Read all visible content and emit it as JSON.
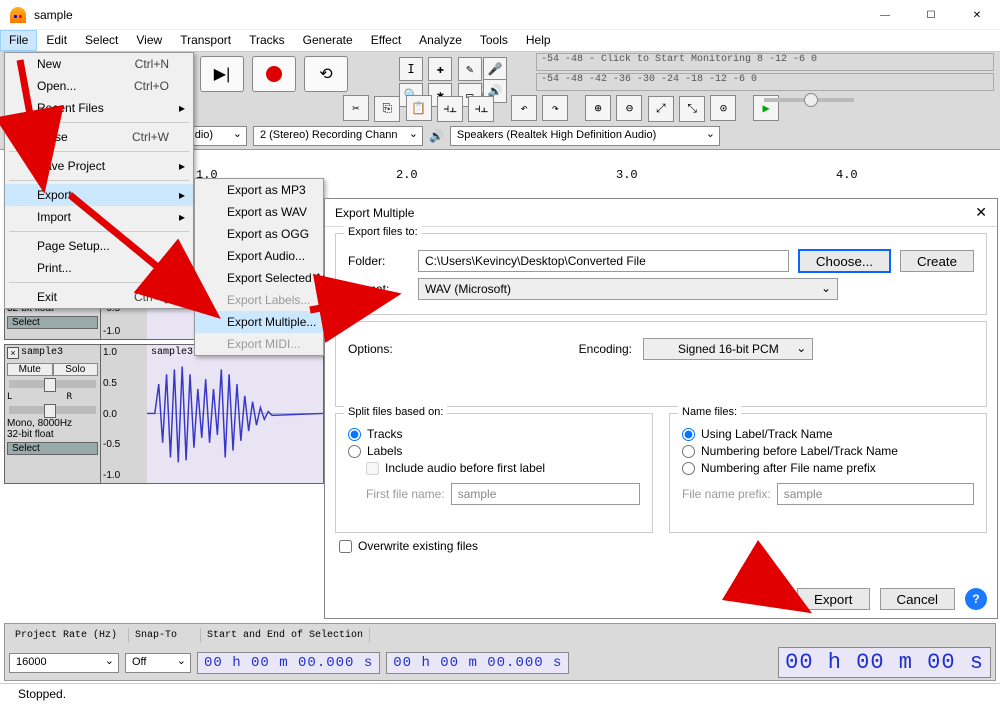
{
  "title": "sample",
  "winbuttons": {
    "min": "—",
    "max": "☐",
    "close": "✕"
  },
  "menubar": [
    "File",
    "Edit",
    "Select",
    "View",
    "Transport",
    "Tracks",
    "Generate",
    "Effect",
    "Analyze",
    "Tools",
    "Help"
  ],
  "fileMenu": [
    {
      "label": "New",
      "shortcut": "Ctrl+N"
    },
    {
      "label": "Open...",
      "shortcut": "Ctrl+O"
    },
    {
      "label": "Recent Files",
      "sub": true
    },
    {
      "sep": true
    },
    {
      "label": "Close",
      "shortcut": "Ctrl+W"
    },
    {
      "sep": true
    },
    {
      "label": "Save Project",
      "sub": true
    },
    {
      "sep": true
    },
    {
      "label": "Export",
      "sub": true,
      "sel": true
    },
    {
      "label": "Import",
      "sub": true
    },
    {
      "sep": true
    },
    {
      "label": "Page Setup..."
    },
    {
      "label": "Print..."
    },
    {
      "sep": true
    },
    {
      "label": "Exit",
      "shortcut": "Ctrl+Q"
    }
  ],
  "exportMenu": [
    {
      "label": "Export as MP3"
    },
    {
      "label": "Export as WAV"
    },
    {
      "label": "Export as OGG"
    },
    {
      "label": "Export Audio..."
    },
    {
      "label": "Export Selected Audio..."
    },
    {
      "label": "Export Labels...",
      "dis": true
    },
    {
      "label": "Export Multiple...",
      "sel": true
    },
    {
      "label": "Export MIDI...",
      "dis": true
    }
  ],
  "toolbars": {
    "meterTop": " -54   -48   - Click to Start Monitoring 8    -12    -6    0",
    "meterBot": "-54        -48        -42        -36        -30        -24        -18        -12         -6          0",
    "devRecLabel": "o Mix (Realtek High Definition Audio)",
    "devChannels": "2 (Stereo) Recording Chann",
    "devPlayLabel": "Speakers (Realtek High Definition Audio)"
  },
  "ruler": {
    "t1": "1.0",
    "t2": "2.0",
    "t3": "3.0",
    "t4": "4.0"
  },
  "tracks": {
    "a": {
      "title": "",
      "info": "32-bit float",
      "select": "Select",
      "valL": "-0.5",
      "valR": "-1.0"
    },
    "b": {
      "title": "sample3",
      "mute": "Mute",
      "solo": "Solo",
      "info": "Mono, 8000Hz\n32-bit float",
      "select": "Select",
      "vals": [
        "1.0",
        "0.5",
        "0.0",
        "-0.5",
        "-1.0"
      ],
      "secondTitle": "sample3"
    }
  },
  "dialog": {
    "title": "Export Multiple",
    "close": "✕",
    "exportFilesTo": "Export files to:",
    "folderLabel": "Folder:",
    "folder": "C:\\Users\\Kevincy\\Desktop\\Converted File",
    "choose": "Choose...",
    "create": "Create",
    "formatLabel": "Format:",
    "format": "WAV (Microsoft)",
    "optionsLabel": "Options:",
    "encodingLabel": "Encoding:",
    "encoding": "Signed 16-bit PCM",
    "splitTitle": "Split files based on:",
    "splitTracks": "Tracks",
    "splitLabels": "Labels",
    "includeLbl": "Include audio before first label",
    "firstFile": "First file name:",
    "firstFileVal": "sample",
    "nameTitle": "Name files:",
    "nameOpt1": "Using Label/Track Name",
    "nameOpt2": "Numbering before Label/Track Name",
    "nameOpt3": "Numbering after File name prefix",
    "prefix": "File name prefix:",
    "prefixVal": "sample",
    "overwrite": "Overwrite existing files",
    "export": "Export",
    "cancel": "Cancel"
  },
  "footer": {
    "projRateHdr": "Project Rate (Hz)",
    "snapHdr": "Snap-To",
    "startEndHdr": "Start and End of Selection",
    "projRate": "16000",
    "snap": "Off",
    "timeA": "00 h 00 m 00.000 s",
    "timeB": "00 h 00 m 00.000 s",
    "bigTime": "00 h 00 m 00 s"
  },
  "status": "Stopped."
}
